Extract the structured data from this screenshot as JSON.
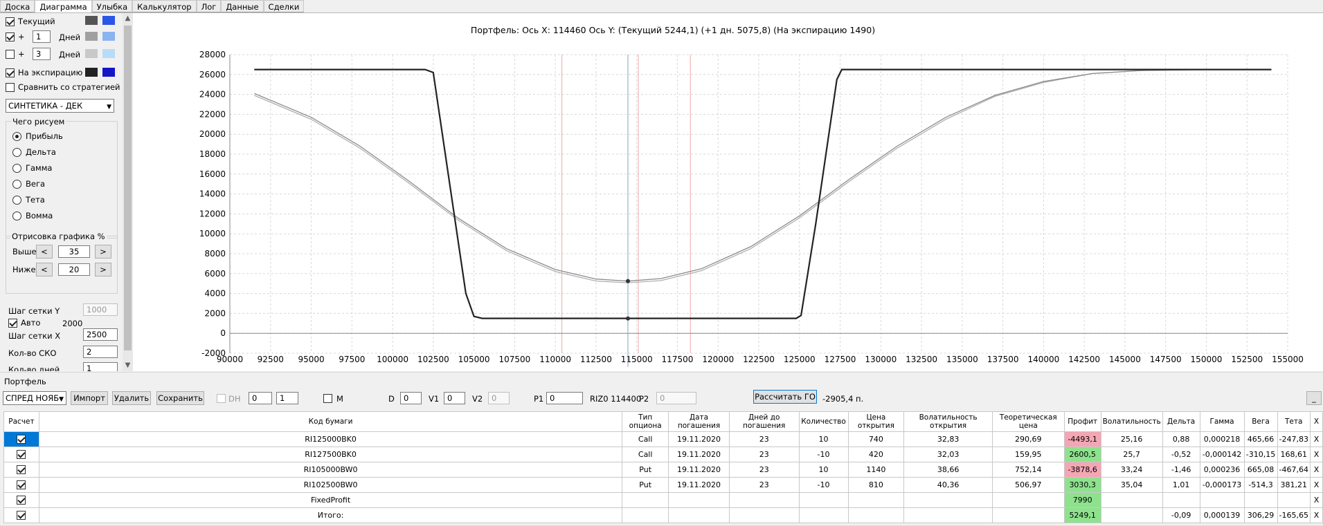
{
  "tabs": [
    "Доска",
    "Диаграмма",
    "Улыбка",
    "Калькулятор",
    "Лог",
    "Данные",
    "Сделки"
  ],
  "active_tab": 1,
  "left": {
    "current_label": "Текущий",
    "plus1": {
      "sign": "+",
      "value": "1",
      "unit": "Дней"
    },
    "plus3": {
      "sign": "+",
      "value": "3",
      "unit": "Дней"
    },
    "expiry_label": "На экспирацию",
    "compare_label": "Сравнить со стратегией",
    "strategy": "СИНТЕТИКА - ДЕК",
    "draw_group": "Чего рисуем",
    "draw_options": [
      "Прибыль",
      "Дельта",
      "Гамма",
      "Вега",
      "Тета",
      "Вомма"
    ],
    "render_group": "Отрисовка графика %",
    "above_label": "Выше",
    "above_value": "35",
    "below_label": "Ниже",
    "below_value": "20",
    "prev": "<",
    "next": ">",
    "grid_y_label": "Шаг сетки Y",
    "grid_y_value": "1000",
    "auto_label": "Авто",
    "auto_value": "2000",
    "grid_x_label": "Шаг сетки X",
    "grid_x_value": "2500",
    "sko_label": "Кол-во СКО",
    "sko_value": "2",
    "days_label": "Кол-во дней",
    "days_value": "1",
    "colors": {
      "current_a": "#555555",
      "current_b": "#2b55e6",
      "plus1_a": "#a0a0a0",
      "plus1_b": "#8ab4f0",
      "plus3_a": "#c8c8c8",
      "plus3_b": "#b8dcf8",
      "expiry_a": "#222222",
      "expiry_b": "#1515c8"
    }
  },
  "chart_header": "Портфель: Ось X: 114460 Ось Y:  (Текущий 5244,1)  (+1 дн. 5075,8)  (На экспирацию 1490)",
  "chart_data": {
    "type": "line",
    "xlim": [
      90000,
      155000
    ],
    "ylim": [
      -2000,
      28000
    ],
    "xticks": [
      90000,
      92500,
      95000,
      97500,
      100000,
      102500,
      105000,
      107500,
      110000,
      112500,
      115000,
      117500,
      120000,
      122500,
      125000,
      127500,
      130000,
      132500,
      135000,
      137500,
      140000,
      142500,
      145000,
      147500,
      150000,
      152500,
      155000
    ],
    "yticks": [
      -2000,
      0,
      2000,
      4000,
      6000,
      8000,
      10000,
      12000,
      14000,
      16000,
      18000,
      20000,
      22000,
      24000,
      26000,
      28000
    ],
    "grid": true,
    "cursor_x": 114460,
    "red_lines": [
      110400,
      115100,
      118300
    ],
    "series": [
      {
        "color": "#222222",
        "points": [
          [
            91500,
            26500
          ],
          [
            102000,
            26500
          ],
          [
            102500,
            26200
          ],
          [
            104500,
            4000
          ],
          [
            105000,
            1700
          ],
          [
            105500,
            1500
          ],
          [
            124800,
            1500
          ],
          [
            125100,
            1800
          ],
          [
            126000,
            11000
          ],
          [
            127300,
            25500
          ],
          [
            127600,
            26500
          ],
          [
            154000,
            26500
          ]
        ]
      },
      {
        "color": "#8a8a8a",
        "points": [
          [
            91500,
            24100
          ],
          [
            95000,
            21700
          ],
          [
            98000,
            18800
          ],
          [
            101000,
            15300
          ],
          [
            104000,
            11600
          ],
          [
            107000,
            8500
          ],
          [
            110000,
            6400
          ],
          [
            112500,
            5450
          ],
          [
            114460,
            5244
          ],
          [
            116500,
            5500
          ],
          [
            119000,
            6500
          ],
          [
            122000,
            8700
          ],
          [
            125000,
            11800
          ],
          [
            128000,
            15400
          ],
          [
            131000,
            18800
          ],
          [
            134000,
            21700
          ],
          [
            137000,
            23900
          ],
          [
            140000,
            25300
          ],
          [
            143000,
            26100
          ],
          [
            146000,
            26400
          ],
          [
            150000,
            26500
          ],
          [
            154000,
            26500
          ]
        ]
      },
      {
        "color": "#b0b0b0",
        "points": [
          [
            91500,
            23900
          ],
          [
            95000,
            21500
          ],
          [
            98000,
            18600
          ],
          [
            101000,
            15100
          ],
          [
            104000,
            11400
          ],
          [
            107000,
            8300
          ],
          [
            110000,
            6200
          ],
          [
            112500,
            5250
          ],
          [
            114460,
            5076
          ],
          [
            116500,
            5300
          ],
          [
            119000,
            6300
          ],
          [
            122000,
            8500
          ],
          [
            125000,
            11600
          ],
          [
            128000,
            15200
          ],
          [
            131000,
            18600
          ],
          [
            134000,
            21500
          ],
          [
            137000,
            23800
          ],
          [
            140000,
            25200
          ],
          [
            143000,
            26100
          ],
          [
            146000,
            26400
          ],
          [
            150000,
            26500
          ],
          [
            154000,
            26500
          ]
        ]
      }
    ],
    "markers": [
      [
        114460,
        5244
      ],
      [
        114460,
        1490
      ]
    ]
  },
  "portfolio": {
    "label": "Портфель",
    "spread_combo": "СПРЕД НОЯБ",
    "import": "Импорт",
    "delete": "Удалить",
    "save": "Сохранить",
    "dh_label": "DH",
    "dh_a": "0",
    "dh_b": "1",
    "m_label": "M",
    "d_label": "D",
    "d_value": "0",
    "v1_label": "V1",
    "v1_value": "0",
    "v2_label": "V2",
    "v2_value": "0",
    "p1_label": "P1",
    "p1_value": "0",
    "riz_text": "RIZ0 114400",
    "p2_label": "P2",
    "p2_value": "0",
    "calc_go": "Рассчитать ГО",
    "go_value": "-2905,4 п.",
    "min_btn": "_"
  },
  "table": {
    "headers": [
      "Расчет",
      "Код бумаги",
      "Тип опциона",
      "Дата погашения",
      "Дней до погашения",
      "Количество",
      "Цена открытия",
      "Волатильность открытия",
      "Теоретическая цена",
      "Профит",
      "Волатильность",
      "Дельта",
      "Гамма",
      "Вега",
      "Тета",
      "X"
    ],
    "rows": [
      [
        "RI125000BK0",
        "Call",
        "19.11.2020",
        "23",
        "10",
        "740",
        "32,83",
        "290,69",
        "-4493,1",
        "25,16",
        "0,88",
        "0,000218",
        "465,66",
        "-247,83",
        "X"
      ],
      [
        "RI127500BK0",
        "Call",
        "19.11.2020",
        "23",
        "-10",
        "420",
        "32,03",
        "159,95",
        "2600,5",
        "25,7",
        "-0,52",
        "-0,000142",
        "-310,15",
        "168,61",
        "X"
      ],
      [
        "RI105000BW0",
        "Put",
        "19.11.2020",
        "23",
        "10",
        "1140",
        "38,66",
        "752,14",
        "-3878,6",
        "33,24",
        "-1,46",
        "0,000236",
        "665,08",
        "-467,64",
        "X"
      ],
      [
        "RI102500BW0",
        "Put",
        "19.11.2020",
        "23",
        "-10",
        "810",
        "40,36",
        "506,97",
        "3030,3",
        "35,04",
        "1,01",
        "-0,000173",
        "-514,3",
        "381,21",
        "X"
      ],
      [
        "FixedProfit",
        "",
        "",
        "",
        "",
        "",
        "",
        "",
        "7990",
        "",
        "",
        "",
        "",
        "",
        "X"
      ],
      [
        "Итого:",
        "",
        "",
        "",
        "",
        "",
        "",
        "",
        "5249,1",
        "",
        "-0,09",
        "0,000139",
        "306,29",
        "-165,65",
        "X"
      ]
    ],
    "profit_colors": [
      "red",
      "green",
      "red",
      "green",
      "green",
      "green"
    ]
  }
}
